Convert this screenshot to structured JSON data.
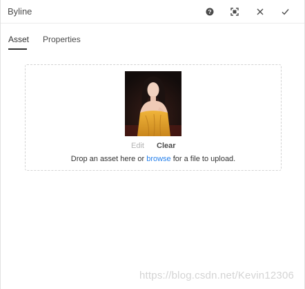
{
  "dialog": {
    "title": "Byline",
    "toolbar": {
      "help_icon": "help-icon",
      "fullscreen_icon": "fullscreen-icon",
      "close_icon": "close-icon",
      "done_icon": "checkmark-icon"
    }
  },
  "tabs": [
    {
      "label": "Asset",
      "selected": true
    },
    {
      "label": "Properties",
      "selected": false
    }
  ],
  "asset": {
    "edit_label": "Edit",
    "clear_label": "Clear",
    "drop_prefix": "Drop an asset here or ",
    "browse_label": "browse",
    "drop_suffix": " for a file to upload."
  },
  "watermark": "https://blog.csdn.net/Kevin12306",
  "colors": {
    "link": "#2680eb",
    "text": "#323232",
    "disabled": "#b3b3b3",
    "dress": "#e0a12a",
    "background_photo": "#1a1412"
  }
}
